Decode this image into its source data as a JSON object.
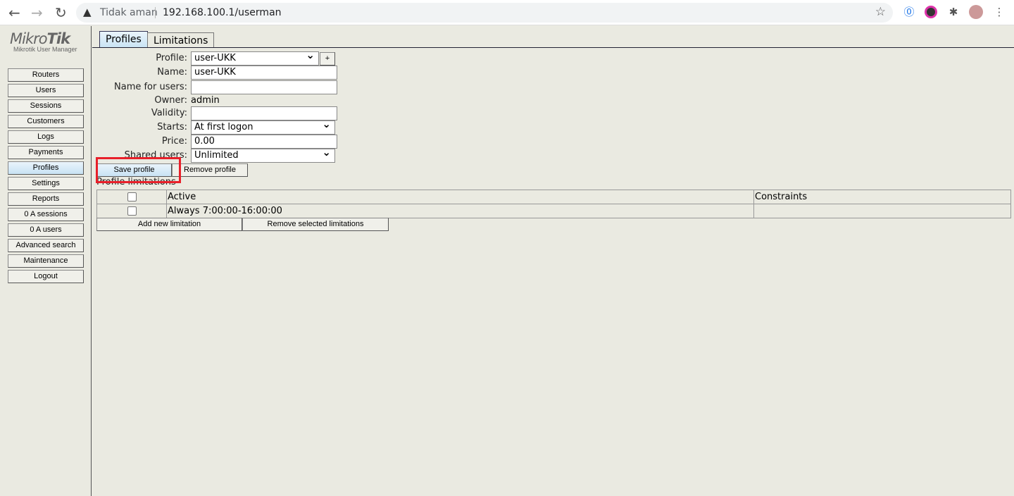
{
  "browser": {
    "security_label": "Tidak aman",
    "url": "192.168.100.1/userman"
  },
  "logo": {
    "brand": "MikroTik",
    "subtitle": "Mikrotik User Manager"
  },
  "sidebar": {
    "items": [
      {
        "label": "Routers"
      },
      {
        "label": "Users"
      },
      {
        "label": "Sessions"
      },
      {
        "label": "Customers"
      },
      {
        "label": "Logs"
      },
      {
        "label": "Payments"
      },
      {
        "label": "Profiles",
        "active": true
      },
      {
        "label": "Settings"
      },
      {
        "label": "Reports"
      },
      {
        "label": "0 A sessions"
      },
      {
        "label": "0 A users"
      },
      {
        "label": "Advanced search"
      },
      {
        "label": "Maintenance"
      },
      {
        "label": "Logout"
      }
    ]
  },
  "tabs": [
    {
      "label": "Profiles",
      "active": true
    },
    {
      "label": "Limitations"
    }
  ],
  "form": {
    "profile_label": "Profile:",
    "profile_value": "user-UKK",
    "add_label": "+",
    "name_label": "Name:",
    "name_value": "user-UKK",
    "name_for_users_label": "Name for users:",
    "name_for_users_value": "",
    "owner_label": "Owner:",
    "owner_value": "admin",
    "validity_label": "Validity:",
    "validity_value": "",
    "starts_label": "Starts:",
    "starts_value": "At first logon",
    "price_label": "Price:",
    "price_value": "0.00",
    "shared_users_label": "Shared users:",
    "shared_users_value": "Unlimited",
    "save_label": "Save profile",
    "remove_label": "Remove profile"
  },
  "limitations": {
    "title": "Profile limitations",
    "headers": [
      "Active",
      "Constraints"
    ],
    "rows": [
      {
        "active": "Always 7:00:00-16:00:00",
        "constraints": ""
      }
    ],
    "add_label": "Add new limitation",
    "remove_label": "Remove selected limitations"
  },
  "colors": {
    "highlight": "#e8202a",
    "background": "#eaeae1"
  }
}
